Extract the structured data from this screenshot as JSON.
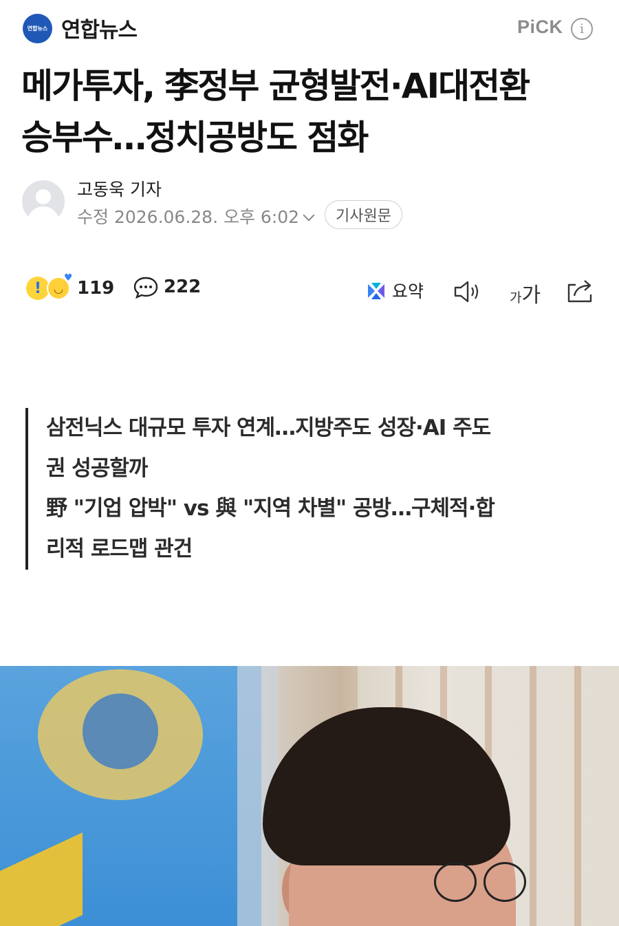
{
  "header": {
    "press_logo_text": "연합뉴스",
    "press_name": "연합뉴스",
    "pick_label": "PiCK",
    "info_symbol": "i"
  },
  "article": {
    "headline_line1": "메가투자, 李정부 균형발전·AI대전환",
    "headline_line2": "승부수…정치공방도 점화",
    "reporter": "고동욱 기자",
    "dateline": "수정 2026.06.28. 오후 6:02",
    "original_button": "기사원문"
  },
  "actions": {
    "reaction_count": "119",
    "comment_count": "222",
    "summary_label": "요약",
    "font_small": "가",
    "font_big": "가"
  },
  "subtitles": {
    "line1": "삼전닉스 대규모 투자 연계…지방주도 성장·AI 주도",
    "line2": "권 성공할까",
    "line3": "野 \"기업 압박\" vs 與 \"지역 차별\" 공방…구체적·합",
    "line4": "리적 로드맵 관건"
  },
  "icons": {
    "info": "info-icon",
    "reaction": "reaction-emoji-icons",
    "comment": "comment-bubble-icon",
    "summary": "ai-summary-icon",
    "speaker": "speaker-icon",
    "font": "font-size-icon",
    "share": "share-icon"
  },
  "colors": {
    "press_brand": "#1f58b6",
    "summary_accent": "#3b82f6"
  }
}
